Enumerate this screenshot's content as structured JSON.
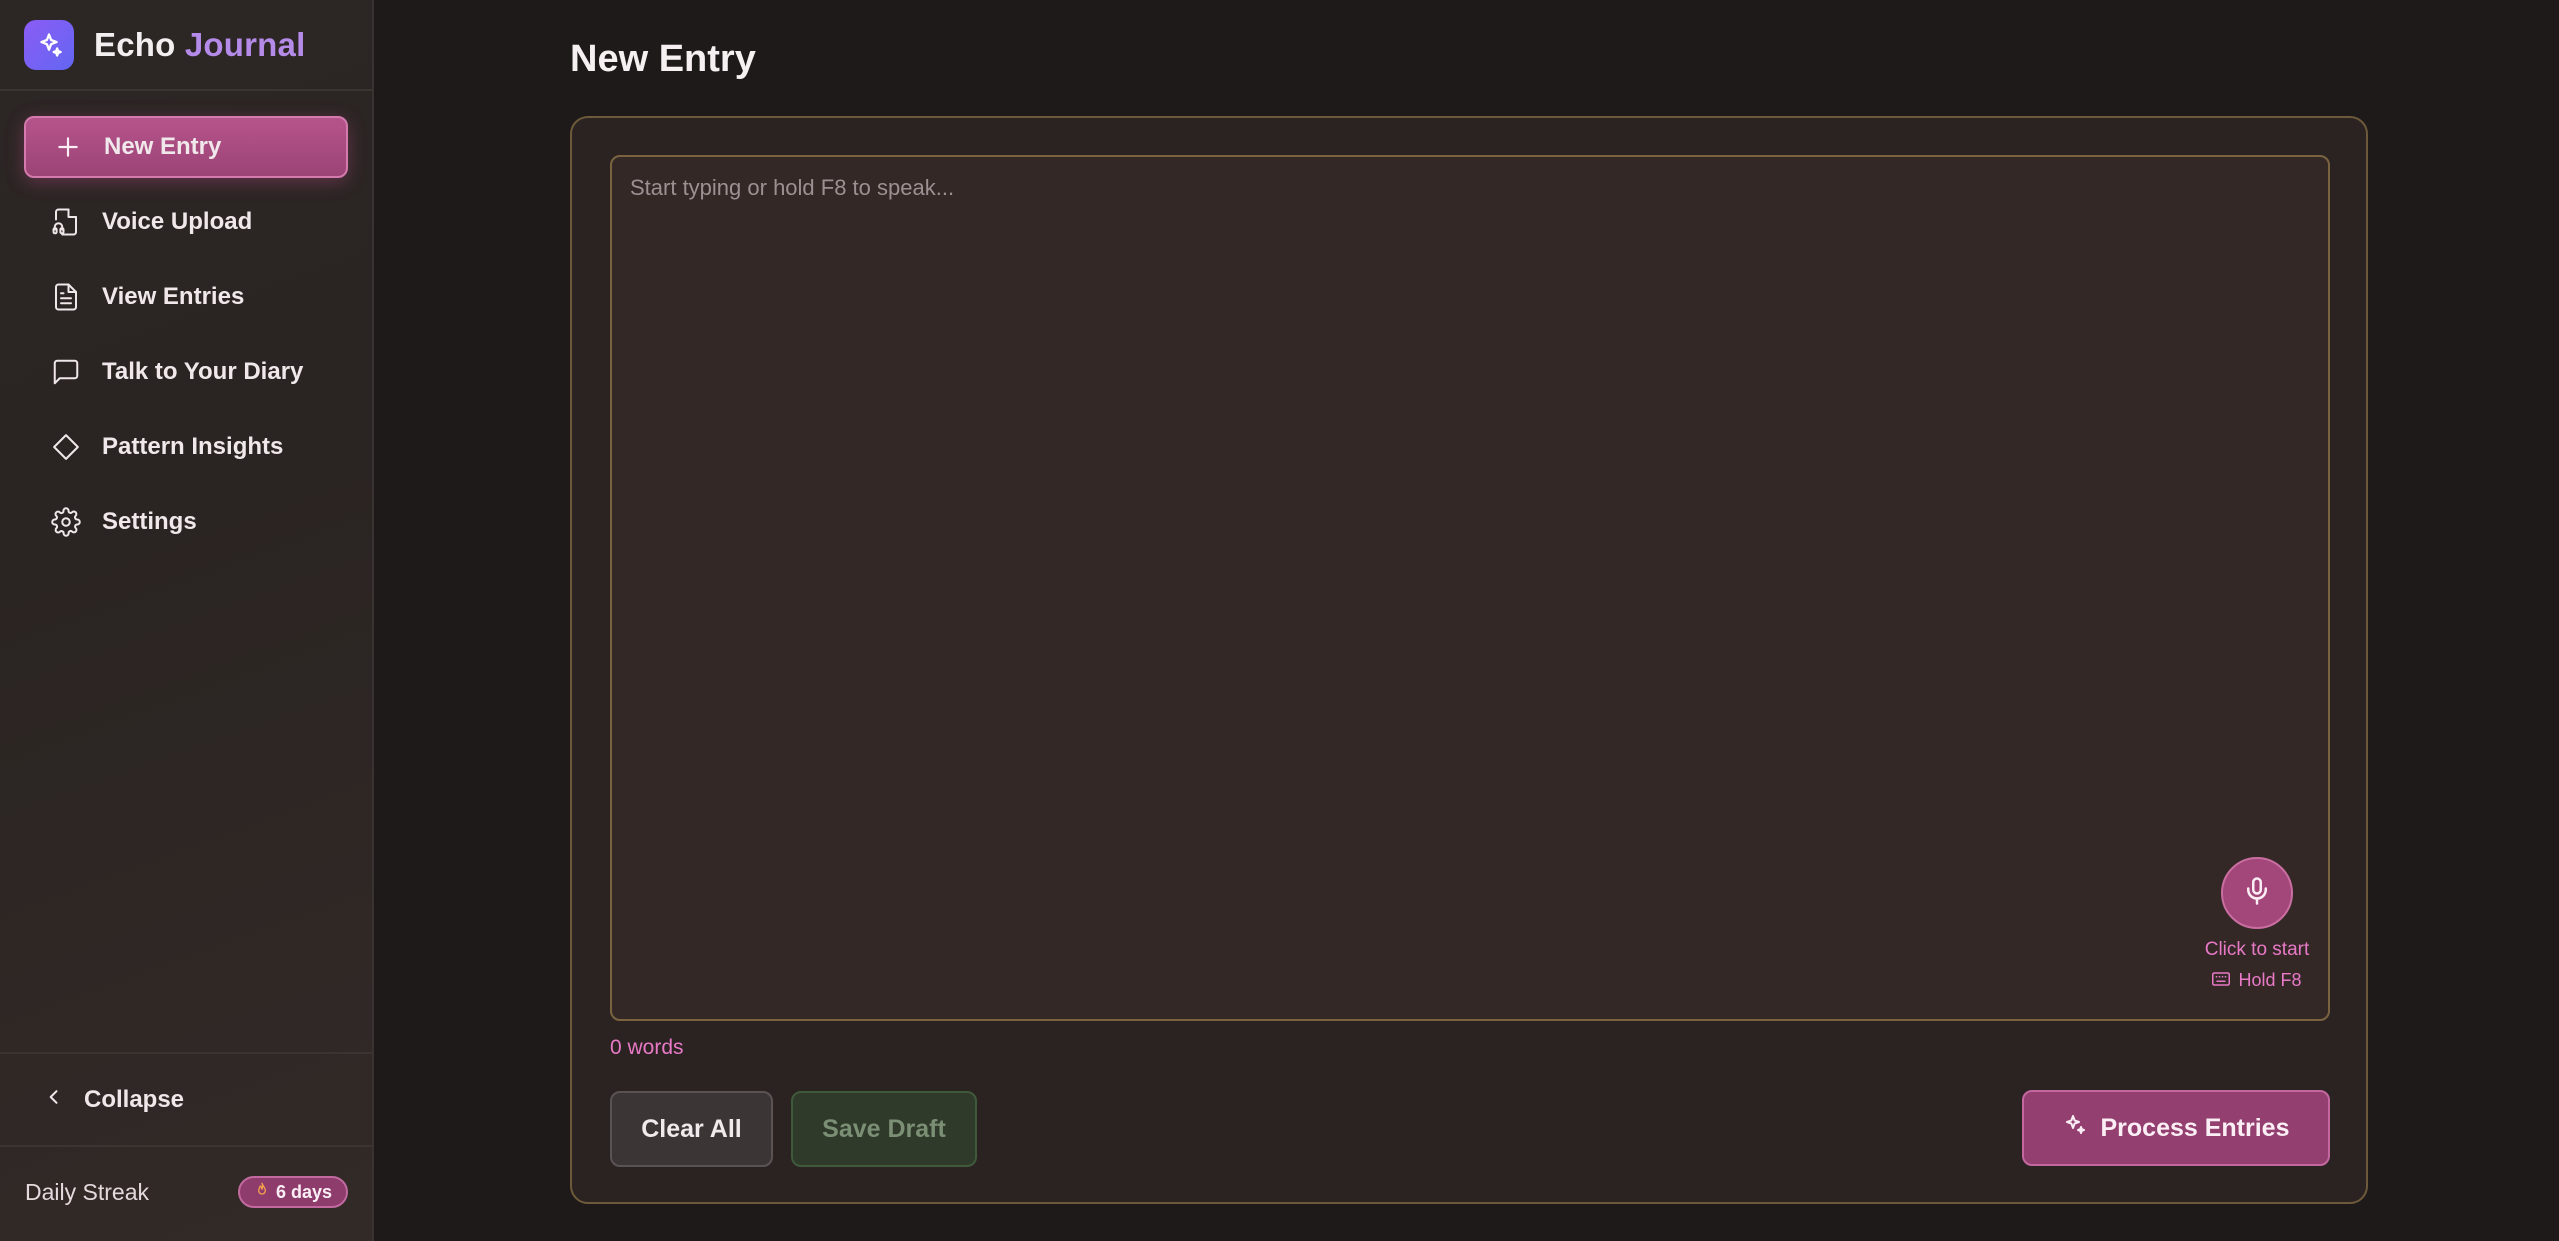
{
  "brand": {
    "name_part1": "Echo",
    "name_part2": "Journal"
  },
  "sidebar": {
    "items": [
      {
        "label": "New Entry",
        "icon": "plus-icon",
        "active": true
      },
      {
        "label": "Voice Upload",
        "icon": "file-audio-icon",
        "active": false
      },
      {
        "label": "View Entries",
        "icon": "document-icon",
        "active": false
      },
      {
        "label": "Talk to Your Diary",
        "icon": "chat-bubble-icon",
        "active": false
      },
      {
        "label": "Pattern Insights",
        "icon": "diamond-icon",
        "active": false
      },
      {
        "label": "Settings",
        "icon": "gear-icon",
        "active": false
      }
    ],
    "collapse_label": "Collapse",
    "streak": {
      "label": "Daily Streak",
      "value": "6 days"
    }
  },
  "main": {
    "title": "New Entry",
    "editor": {
      "placeholder": "Start typing or hold F8 to speak...",
      "value": ""
    },
    "mic": {
      "hint": "Click to start",
      "shortcut": "Hold F8"
    },
    "word_count": "0 words",
    "buttons": {
      "clear": "Clear All",
      "save_draft": "Save Draft",
      "process": "Process Entries"
    }
  },
  "colors": {
    "accent": "#b5548c",
    "accent_text": "#e879c6",
    "brand_secondary": "#b48be9",
    "card_border": "#6e5a3b"
  }
}
